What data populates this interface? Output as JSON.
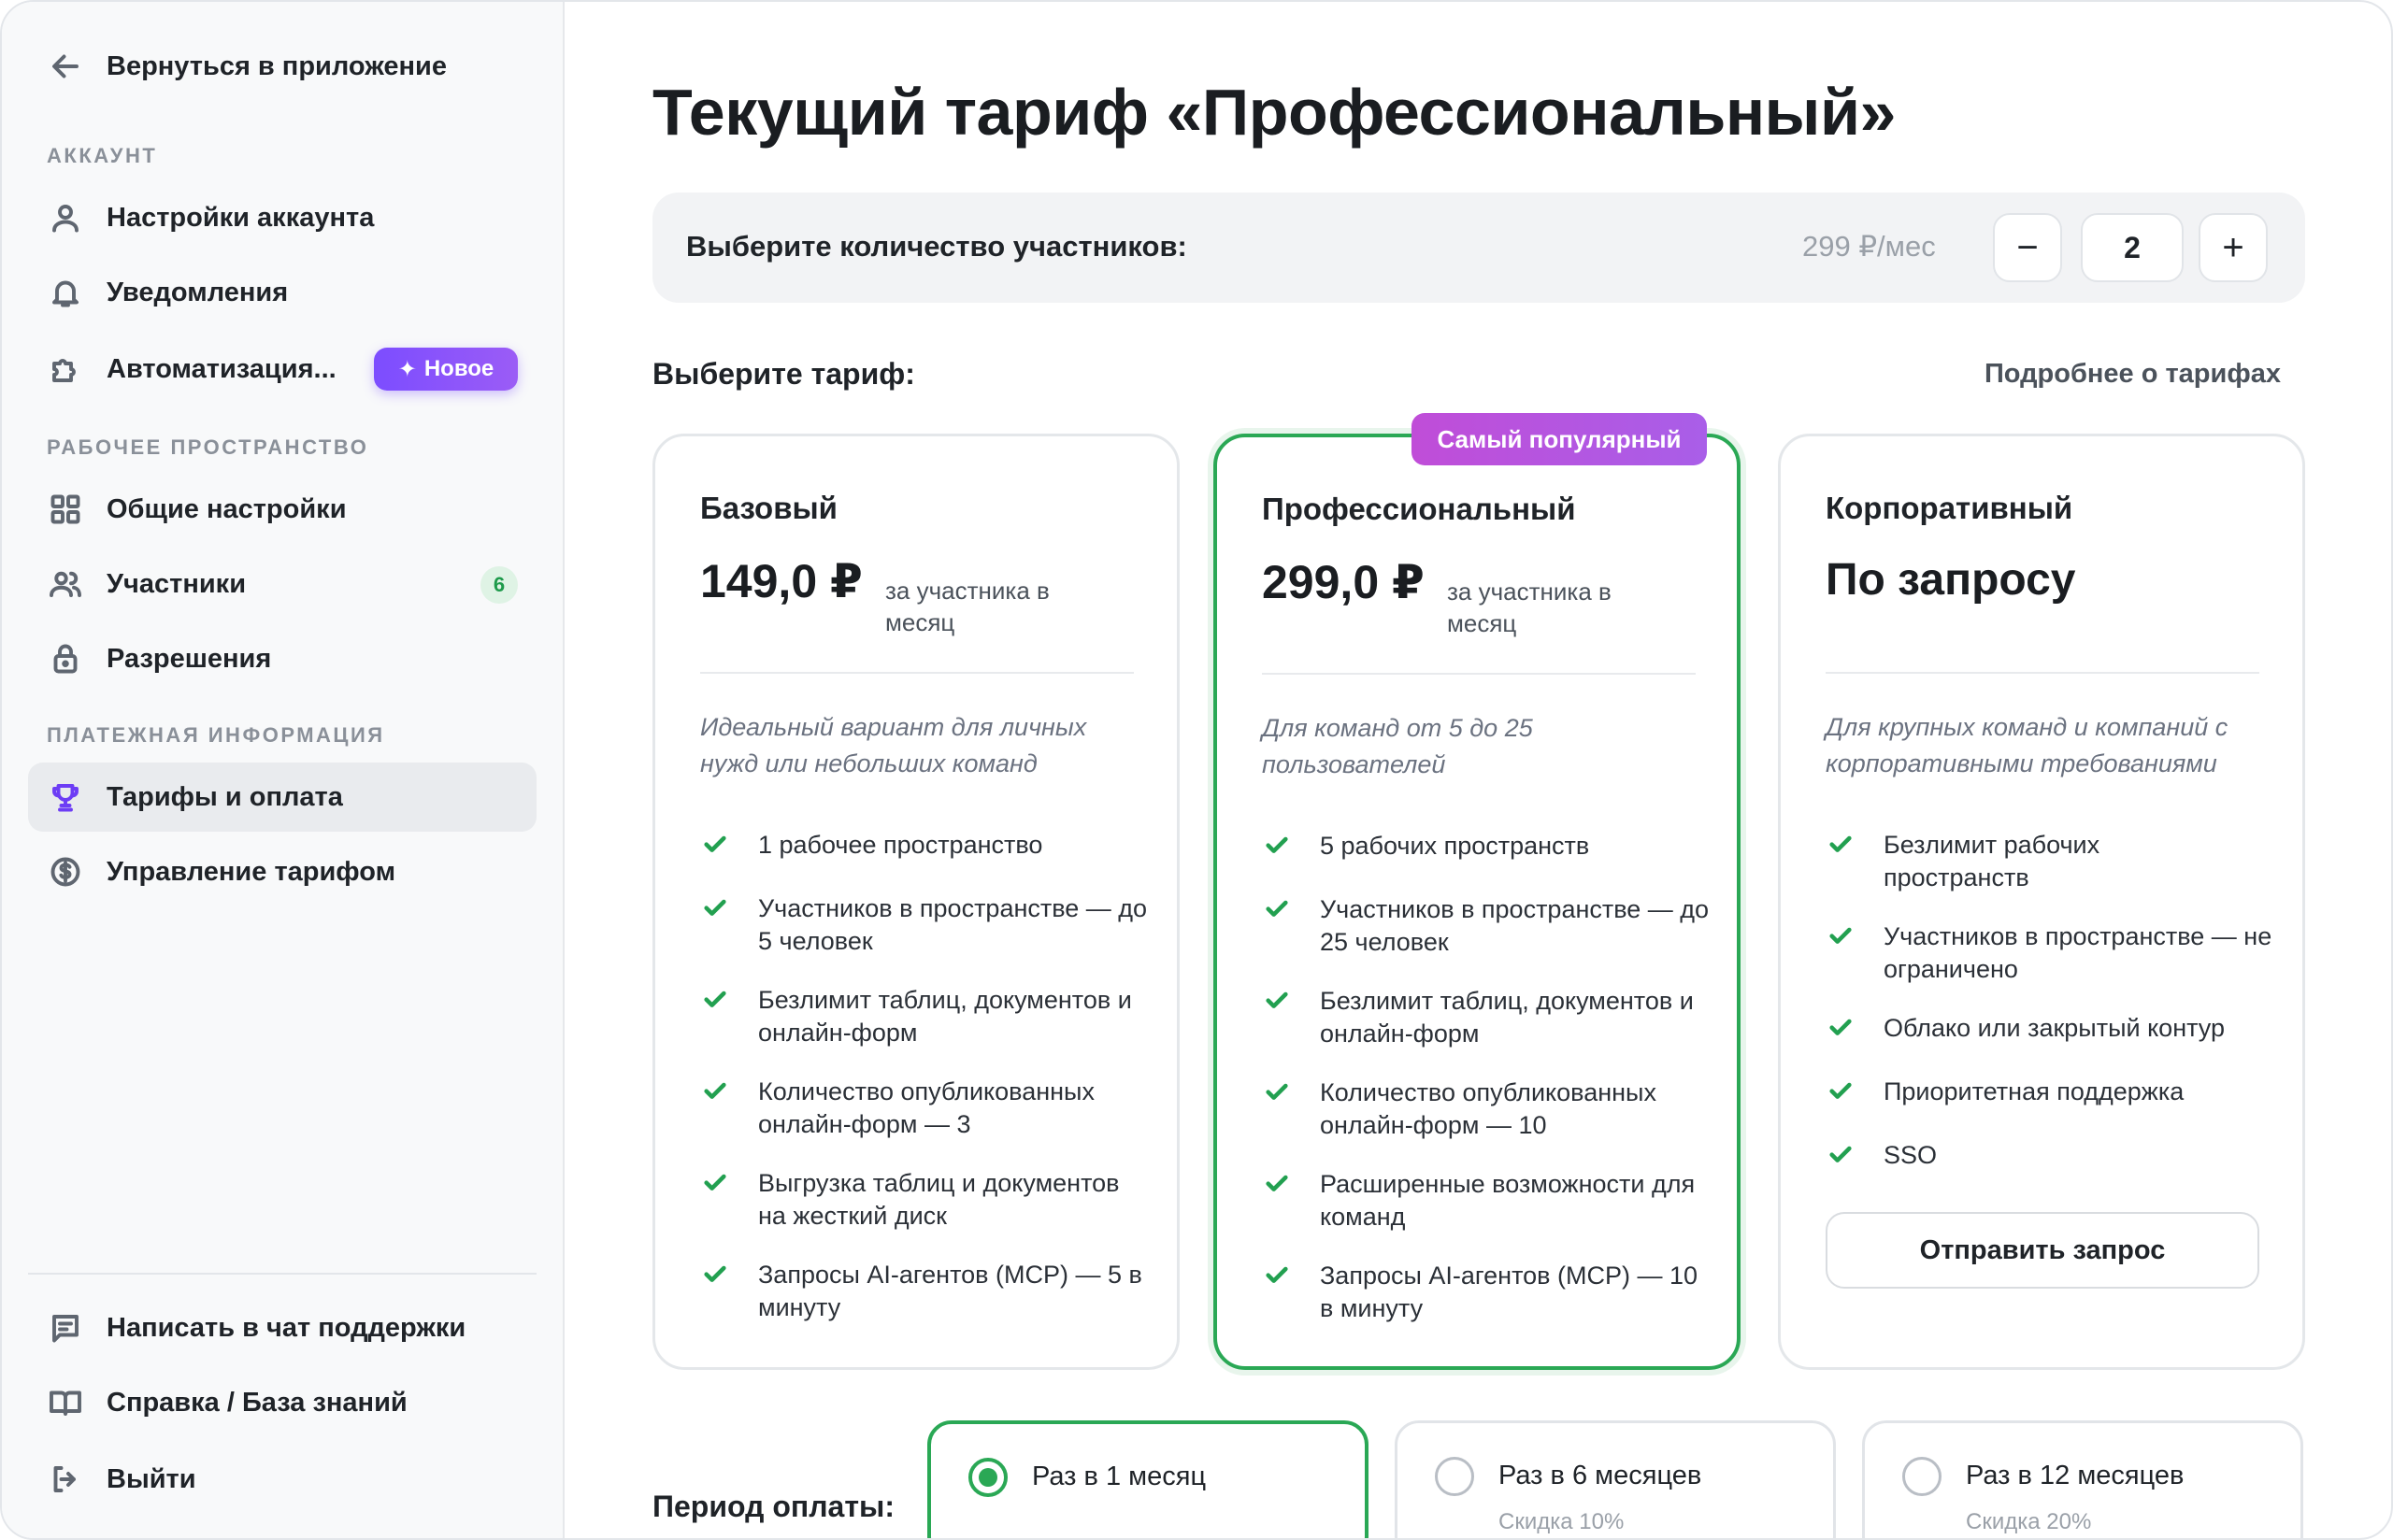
{
  "sidebar": {
    "back_label": "Вернуться в приложение",
    "sections": {
      "account": "АККАУНТ",
      "workspace": "РАБОЧЕЕ ПРОСТРАНСТВО",
      "billing": "ПЛАТЕЖНАЯ ИНФОРМАЦИЯ"
    },
    "items": {
      "account_settings": "Настройки аккаунта",
      "notifications": "Уведомления",
      "automation": "Автоматизация...",
      "general_settings": "Общие настройки",
      "members": "Участники",
      "permissions": "Разрешения",
      "plans": "Тарифы и оплата",
      "plan_management": "Управление тарифом"
    },
    "new_badge": "Новое",
    "members_count": "6",
    "footer": {
      "support_chat": "Написать в чат поддержки",
      "help": "Справка / База знаний",
      "logout": "Выйти"
    }
  },
  "main": {
    "title": "Текущий тариф «Профессиональный»",
    "members_prompt": "Выберите количество участников:",
    "member_price": "299 ₽/мес",
    "member_count": "2",
    "decrement_symbol": "−",
    "increment_symbol": "+",
    "choose_plan": "Выберите тариф:",
    "more_link": "Подробнее о тарифах",
    "popular_tag": "Самый популярный",
    "plans": [
      {
        "name": "Базовый",
        "price": "149,0 ₽",
        "per": "за участника в месяц",
        "desc": "Идеальный вариант для личных нужд или небольших команд",
        "features": [
          "1 рабочее пространство",
          "Участников в пространстве — до 5 человек",
          "Безлимит таблиц, документов и онлайн-форм",
          "Количество опубликованных онлайн-форм — 3",
          "Выгрузка таблиц и документов на жесткий диск",
          "Запросы AI-агентов (MCP) — 5 в минуту"
        ]
      },
      {
        "name": "Профессиональный",
        "price": "299,0 ₽",
        "per": "за участника в месяц",
        "desc": "Для команд от 5 до 25 пользователей",
        "features": [
          "5 рабочих пространств",
          "Участников в пространстве — до 25 человек",
          "Безлимит таблиц, документов и онлайн-форм",
          "Количество опубликованных онлайн-форм — 10",
          "Расширенные возможности для команд",
          "Запросы AI-агентов (MCP) — 10 в минуту"
        ]
      },
      {
        "name": "Корпоративный",
        "price": "По запросу",
        "desc": "Для крупных команд и компаний с корпоративными требованиями",
        "features": [
          "Безлимит рабочих пространств",
          "Участников в пространстве — не ограничено",
          "Облако или закрытый контур",
          "Приоритетная поддержка",
          "SSO"
        ],
        "button": "Отправить запрос"
      }
    ],
    "period_title": "Период оплаты:",
    "periods": [
      {
        "label": "Раз в 1 месяц",
        "discount": ""
      },
      {
        "label": "Раз в 6 месяцев",
        "discount": "Скидка 10%"
      },
      {
        "label": "Раз в 12 месяцев",
        "discount": "Скидка 20%"
      }
    ]
  },
  "colors": {
    "accent_green": "#2aa855",
    "new_badge_purple": "#7c4dff",
    "popular_tag_magenta": "#c04dd8",
    "sidebar_bg": "#f8f9fa"
  }
}
